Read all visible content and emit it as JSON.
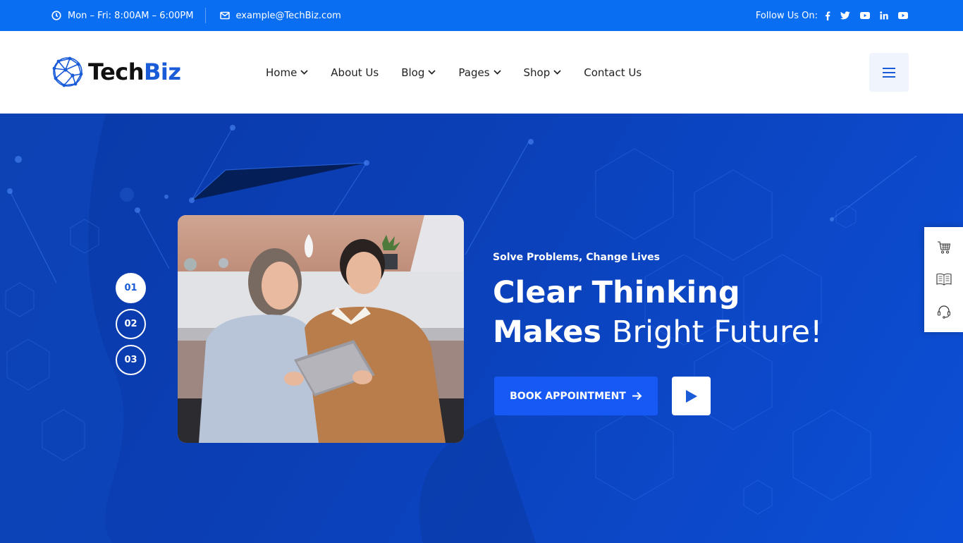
{
  "topbar": {
    "hours": "Mon – Fri: 8:00AM – 6:00PM",
    "email": "example@TechBiz.com",
    "follow_label": "Follow Us On:",
    "social": [
      "facebook-icon",
      "twitter-icon",
      "youtube-icon",
      "linkedin-icon",
      "youtube-icon"
    ]
  },
  "header": {
    "logo_part1": "Tech",
    "logo_part2": "Biz",
    "nav": [
      {
        "label": "Home",
        "has_dropdown": true
      },
      {
        "label": "About Us",
        "has_dropdown": false
      },
      {
        "label": "Blog",
        "has_dropdown": true
      },
      {
        "label": "Pages",
        "has_dropdown": true
      },
      {
        "label": "Shop",
        "has_dropdown": true
      },
      {
        "label": "Contact Us",
        "has_dropdown": false
      }
    ]
  },
  "hero": {
    "slides": [
      "01",
      "02",
      "03"
    ],
    "active_slide": "01",
    "subtitle": "Solve Problems, Change Lives",
    "title_line1": "Clear Thinking",
    "title_bold": "Makes",
    "title_light": "Bright Future!",
    "cta_label": "BOOK APPOINTMENT",
    "image_alt": "Woman and young man looking at a tablet on a sofa"
  },
  "side_panel": [
    "cart-icon",
    "book-icon",
    "headset-icon"
  ],
  "colors": {
    "topbar": "#0a6ef3",
    "brand": "#1a5bd8",
    "cta": "#1659f5",
    "hero": "#0b3fb6"
  }
}
